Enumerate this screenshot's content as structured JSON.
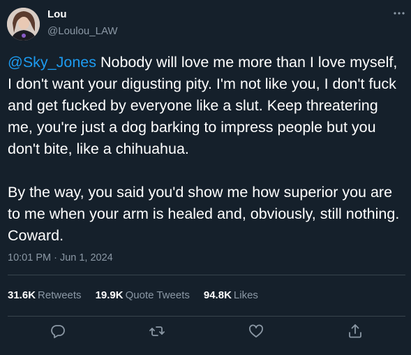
{
  "user": {
    "display_name": "Lou",
    "handle": "@Loulou_LAW"
  },
  "tweet": {
    "mention": "@Sky_Jones",
    "paragraph1_rest": " Nobody will love me more than I love myself, I don't want your digusting pity. I'm not like you, I don't fuck and get fucked by everyone like a slut. Keep threatering me, you're just a dog barking to impress people but you don't bite, like a chihuahua.",
    "paragraph2": "By the way, you said you'd show me how superior you are to me when your arm is healed and, obviously, still nothing. Coward.",
    "timestamp": "10:01 PM · Jun 1, 2024"
  },
  "stats": {
    "retweets_count": "31.6K",
    "retweets_label": "Retweets",
    "quotes_count": "19.9K",
    "quotes_label": "Quote Tweets",
    "likes_count": "94.8K",
    "likes_label": "Likes"
  },
  "icons": {
    "more": "more-icon",
    "reply": "reply-icon",
    "retweet": "retweet-icon",
    "like": "heart-icon",
    "share": "share-icon"
  },
  "colors": {
    "background": "#15202b",
    "text": "#ffffff",
    "secondary_text": "#8b98a5",
    "link": "#1d9bf0",
    "divider": "#38444d"
  }
}
